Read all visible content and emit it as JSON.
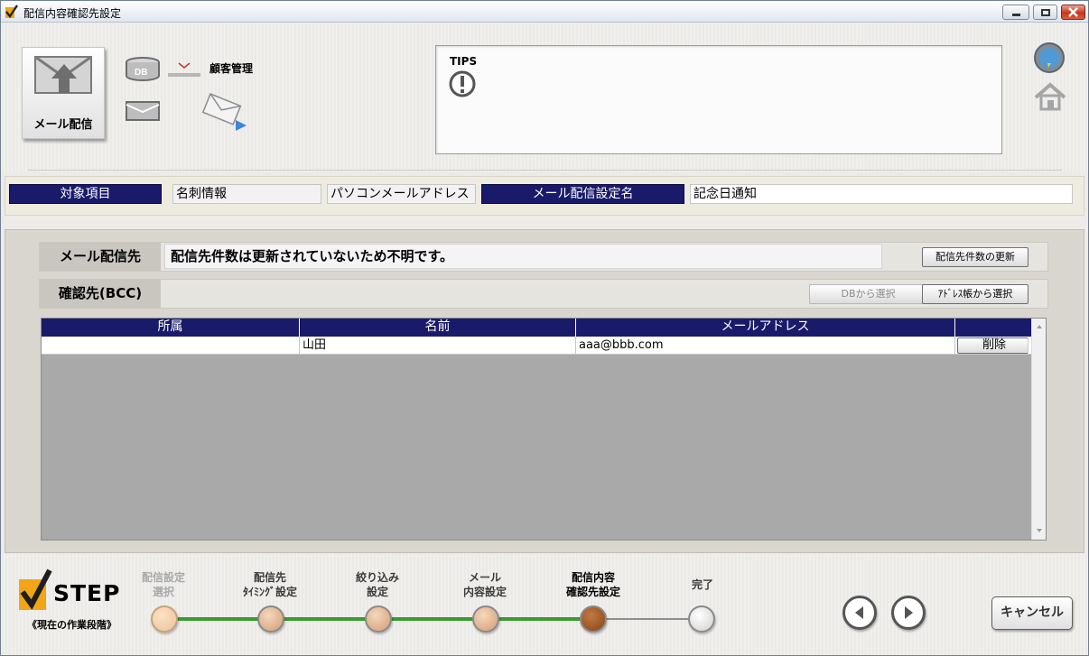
{
  "window": {
    "title": "配信内容確認先設定"
  },
  "header": {
    "mail_tile_label": "メール配信",
    "db_label": "顧客管理",
    "tips_title": "TIPS"
  },
  "info": {
    "target_label": "対象項目",
    "target_value": "名刺情報",
    "address_value": "パソコンメールアドレス",
    "setting_label": "メール配信設定名",
    "setting_value": "記念日通知"
  },
  "recipients": {
    "label": "メール配信先",
    "message": "配信先件数は更新されていないため不明です。",
    "update_button": "配信先件数の更新"
  },
  "bcc": {
    "label": "確認先(BCC)",
    "db_select_button": "DBから選択",
    "address_book_button": "ｱﾄﾞﾚｽ帳から選択"
  },
  "table": {
    "columns": [
      "所属",
      "名前",
      "メールアドレス",
      ""
    ],
    "rows": [
      {
        "affiliation": "",
        "name": "山田",
        "email": "aaa@bbb.com",
        "action": "削除"
      }
    ]
  },
  "steps": {
    "title": "STEP",
    "subtitle": "《現在の作業段階》",
    "items": [
      {
        "line1": "配信設定",
        "line2": "選択",
        "state": "done"
      },
      {
        "line1": "配信先",
        "line2": "ﾀｲﾐﾝｸﾞ設定",
        "state": "done"
      },
      {
        "line1": "絞り込み",
        "line2": "設定",
        "state": "done"
      },
      {
        "line1": "メール",
        "line2": "内容設定",
        "state": "done"
      },
      {
        "line1": "配信内容",
        "line2": "確認先設定",
        "state": "current"
      },
      {
        "line1": "完了",
        "line2": "",
        "state": "pending"
      }
    ]
  },
  "footer": {
    "cancel_button": "キャンセル"
  },
  "colors": {
    "navy": "#1a1a6b",
    "step_done": "#ecc29b",
    "step_current": "#9a4f1f",
    "step_pending": "#d9d9d9",
    "progress_line": "#3a9a2e"
  }
}
